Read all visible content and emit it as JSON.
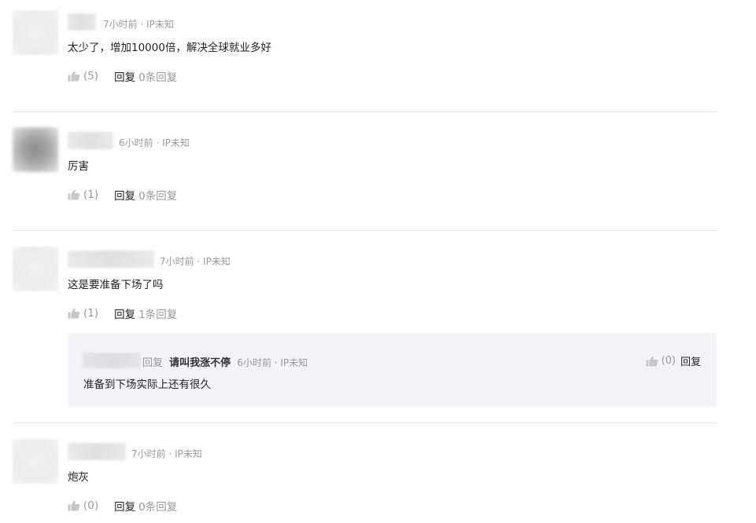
{
  "icons": {
    "like": "thumbs-up-icon"
  },
  "comments": [
    {
      "time_ip": "7小时前 · IP未知",
      "text": "太少了，增加10000倍，解决全球就业多好",
      "likes": "(5)",
      "reply_label": "回复",
      "reply_count": "0条回复"
    },
    {
      "time_ip": "6小时前 · IP未知",
      "text": "厉害",
      "likes": "(1)",
      "reply_label": "回复",
      "reply_count": "0条回复"
    },
    {
      "time_ip": "7小时前 · IP未知",
      "text": "这是要准备下场了吗",
      "likes": "(1)",
      "reply_label": "回复",
      "reply_count": "1条回复",
      "sub_reply": {
        "reply_word": "回复",
        "target_user": "请叫我涨不停",
        "time_ip": "6小时前 · IP未知",
        "text": "准备到下场实际上还有很久",
        "likes": "(0)",
        "reply_label": "回复"
      }
    },
    {
      "time_ip": "7小时前 · IP未知",
      "text": "炮灰",
      "likes": "(0)",
      "reply_label": "回复",
      "reply_count": "0条回复"
    }
  ]
}
